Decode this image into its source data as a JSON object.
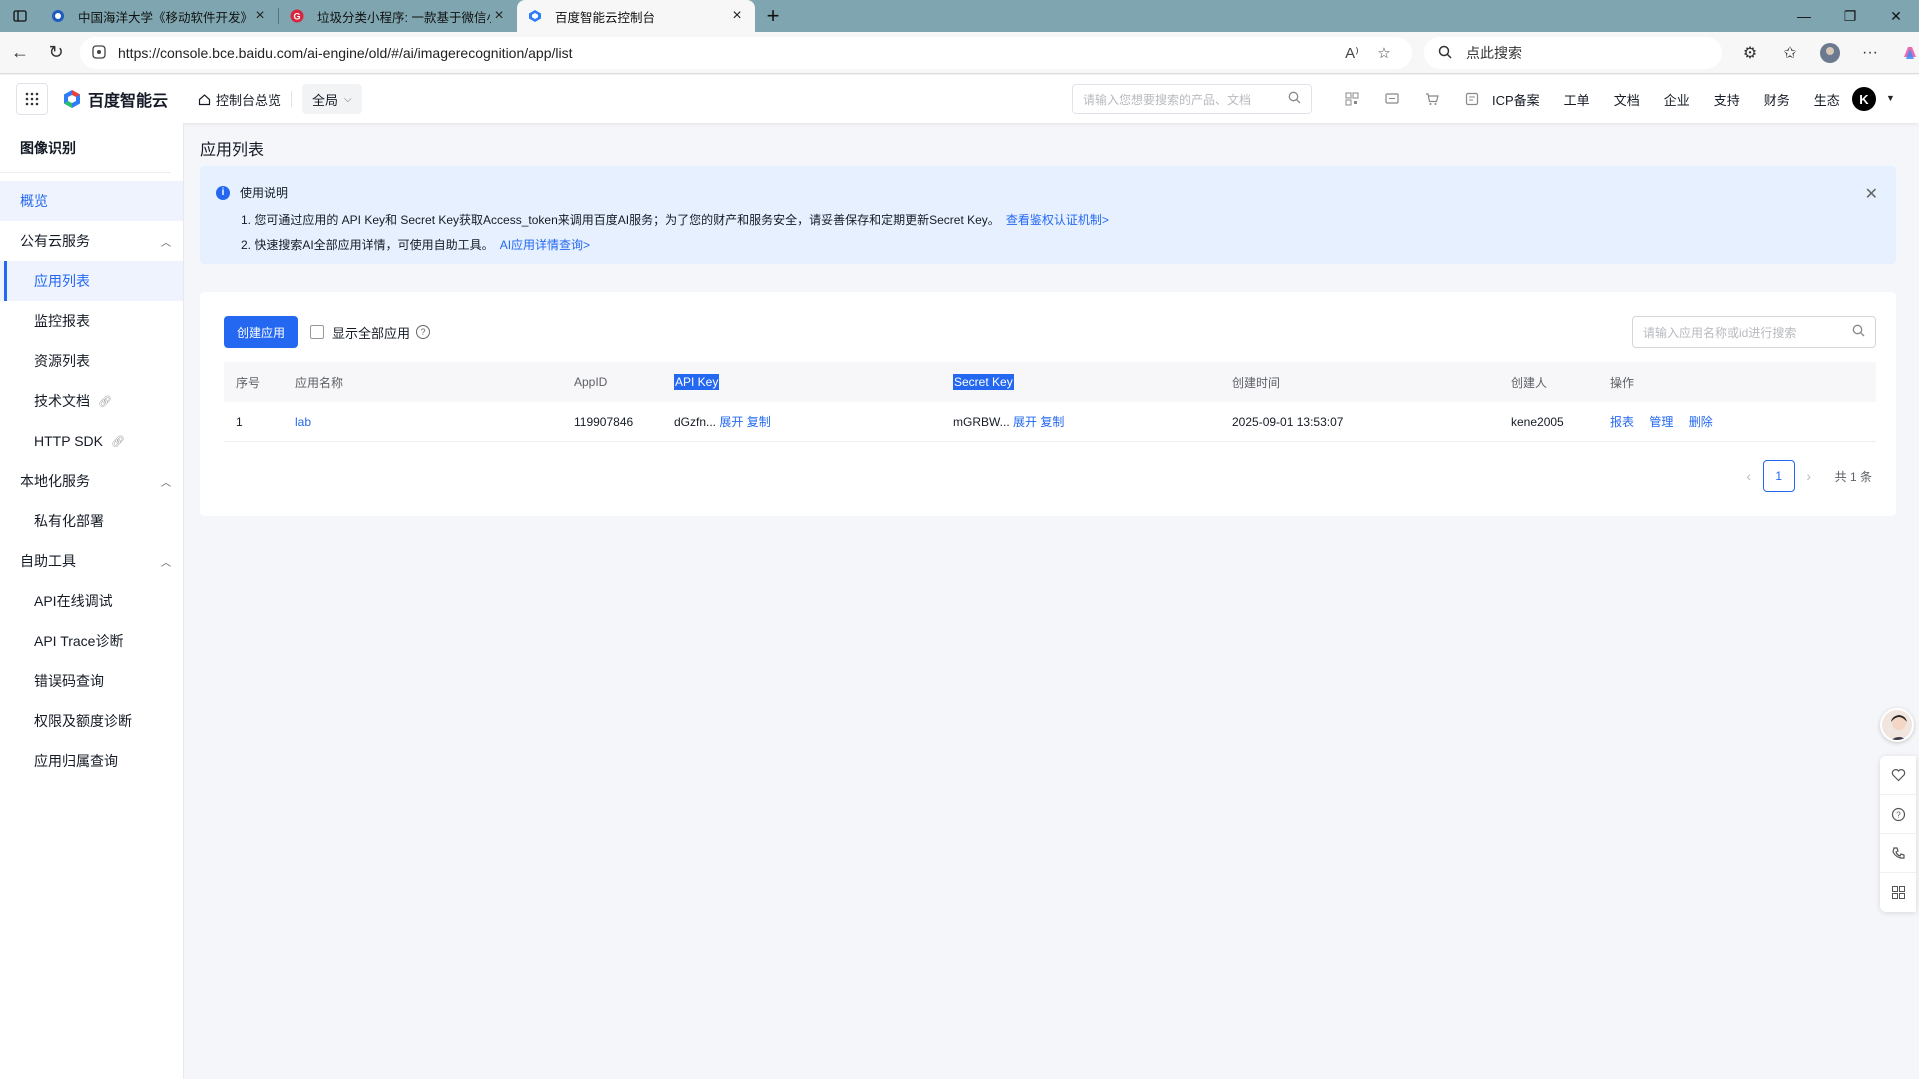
{
  "browser": {
    "tabs": [
      {
        "title": "中国海洋大学《移动软件开发》课",
        "favicon": "blue-shield-icon",
        "active": false
      },
      {
        "title": "垃圾分类小程序: 一款基于微信小",
        "favicon": "red-g-icon",
        "active": false
      },
      {
        "title": "百度智能云控制台",
        "favicon": "baidu-cloud-icon",
        "active": true
      }
    ],
    "url": "https://console.bce.baidu.com/ai-engine/old/#/ai/imagerecognition/app/list",
    "search_text": "点此搜索"
  },
  "header": {
    "brand": "百度智能云",
    "home_label": "控制台总览",
    "region": "全局",
    "search_placeholder": "请输入您想要搜索的产品、文档",
    "links": [
      "ICP备案",
      "工单",
      "文档",
      "企业",
      "支持",
      "财务",
      "生态"
    ],
    "avatar_letter": "K"
  },
  "sidebar": {
    "title": "图像识别",
    "overview": "概览",
    "groups": [
      {
        "label": "公有云服务",
        "items": [
          "应用列表",
          "监控报表",
          "资源列表",
          "技术文档",
          "HTTP SDK"
        ]
      },
      {
        "label": "本地化服务",
        "items": [
          "私有化部署"
        ]
      },
      {
        "label": "自助工具",
        "items": [
          "API在线调试",
          "API Trace诊断",
          "错误码查询",
          "权限及额度诊断",
          "应用归属查询"
        ]
      }
    ]
  },
  "main": {
    "title": "应用列表",
    "notice": {
      "heading": "使用说明",
      "line1": "1. 您可通过应用的 API Key和 Secret Key获取Access_token来调用百度AI服务；为了您的财产和服务安全，请妥善保存和定期更新Secret Key。",
      "line1_link": "查看鉴权认证机制>",
      "line2": "2. 快速搜索AI全部应用详情，可使用自助工具。",
      "line2_link": "AI应用详情查询>"
    },
    "create_button": "创建应用",
    "show_all_label": "显示全部应用",
    "search_placeholder": "请输入应用名称或id进行搜索",
    "table": {
      "headers": [
        "序号",
        "应用名称",
        "AppID",
        "API Key",
        "Secret Key",
        "创建时间",
        "创建人",
        "操作"
      ],
      "rows": [
        {
          "no": "1",
          "name": "lab",
          "appid": "119907846",
          "api_key": "dGzfn...",
          "secret_key": "mGRBW...",
          "expand": "展开",
          "copy": "复制",
          "created": "2025-09-01 13:53:07",
          "creator": "kene2005",
          "ops": [
            "报表",
            "管理",
            "删除"
          ]
        }
      ]
    },
    "pagination": {
      "current": "1",
      "total": "共 1 条"
    }
  }
}
